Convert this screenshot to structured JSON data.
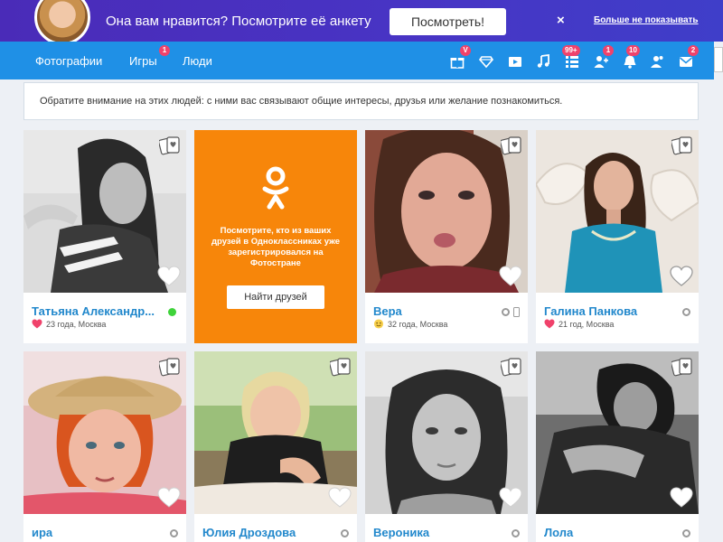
{
  "promo": {
    "text": "Она вам нравится? Посмотрите её анкету",
    "view_button": "Посмотреть!",
    "close": "×",
    "hide_link": "Больше не показывать"
  },
  "nav": {
    "links": [
      "Фотографии",
      "Игры",
      "Люди"
    ],
    "games_badge": "1",
    "icons": [
      {
        "name": "gift-icon",
        "badge": "V"
      },
      {
        "name": "diamond-icon",
        "badge": ""
      },
      {
        "name": "video-icon",
        "badge": ""
      },
      {
        "name": "music-icon",
        "badge": ""
      },
      {
        "name": "list-icon",
        "badge": "99+"
      },
      {
        "name": "friends-icon",
        "badge": "1"
      },
      {
        "name": "bell-icon",
        "badge": "10"
      },
      {
        "name": "guests-icon",
        "badge": ""
      },
      {
        "name": "mail-icon",
        "badge": "2"
      }
    ]
  },
  "notice": "Обратите внимание на этих людей: с ними вас связывают общие интересы, друзья или желание познакомиться.",
  "ok_promo": {
    "text": "Посмотрите, кто из ваших друзей в Одноклассниках уже зарегистрировался на Фотостране",
    "button": "Найти друзей"
  },
  "cards": [
    {
      "name": "Татьяна Александр...",
      "age": "23 года, Москва",
      "status": "online",
      "meta_icon": "heart"
    },
    {
      "name": "Вера",
      "age": "32 года, Москва",
      "status": "mobile",
      "meta_icon": "smile"
    },
    {
      "name": "Галина Панкова",
      "age": "21 год, Москва",
      "status": "offline",
      "meta_icon": "heart"
    },
    {
      "name": "ира",
      "age": "",
      "status": "offline",
      "meta_icon": "smile"
    },
    {
      "name": "Юлия Дроздова",
      "age": "",
      "status": "offline",
      "meta_icon": ""
    },
    {
      "name": "Вероника",
      "age": "",
      "status": "offline",
      "meta_icon": "smile"
    },
    {
      "name": "Лола",
      "age": "",
      "status": "offline",
      "meta_icon": ""
    }
  ],
  "colors": {
    "accent": "#1f90e6",
    "promo": "#4834c4",
    "ok_orange": "#f7860a",
    "name_link": "#2288cc",
    "badge": "#f0426b"
  }
}
